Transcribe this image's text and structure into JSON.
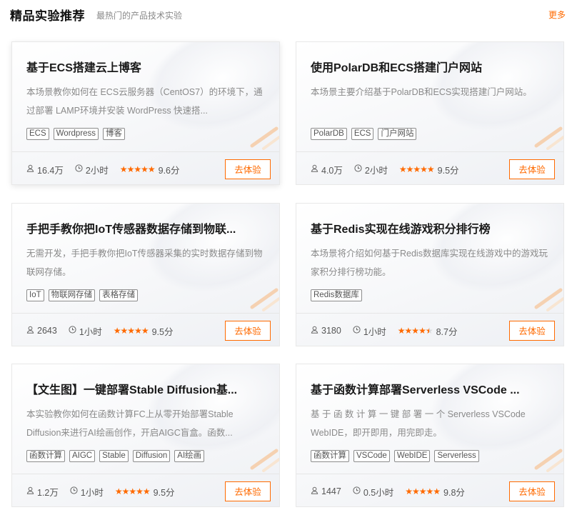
{
  "header": {
    "title": "精品实验推荐",
    "subtitle": "最热门的产品技术实验",
    "more": "更多"
  },
  "cards": [
    {
      "title": "基于ECS搭建云上博客",
      "desc": "本场景教你如何在 ECS云服务器（CentOS7）的环境下，通过部署 LAMP环境并安装 WordPress 快速搭...",
      "tags": [
        "ECS",
        "Wordpress",
        "博客"
      ],
      "users": "16.4万",
      "duration": "2小时",
      "rating": 5,
      "score": "9.6分",
      "button": "去体验"
    },
    {
      "title": "使用PolarDB和ECS搭建门户网站",
      "desc": "本场景主要介绍基于PolarDB和ECS实现搭建门户网站。",
      "tags": [
        "PolarDB",
        "ECS",
        "门户网站"
      ],
      "users": "4.0万",
      "duration": "2小时",
      "rating": 5,
      "score": "9.5分",
      "button": "去体验"
    },
    {
      "title": "手把手教你把IoT传感器数据存储到物联...",
      "desc": "无需开发，手把手教你把IoT传感器采集的实时数据存储到物联网存储。",
      "tags": [
        "IoT",
        "物联网存储",
        "表格存储"
      ],
      "users": "2643",
      "duration": "1小时",
      "rating": 5,
      "score": "9.5分",
      "button": "去体验"
    },
    {
      "title": "基于Redis实现在线游戏积分排行榜",
      "desc": "本场景将介绍如何基于Redis数据库实现在线游戏中的游戏玩家积分排行榜功能。",
      "tags": [
        "Redis数据库"
      ],
      "users": "3180",
      "duration": "1小时",
      "rating": 4.5,
      "score": "8.7分",
      "button": "去体验"
    },
    {
      "title": "【文生图】一键部署Stable Diffusion基...",
      "desc": "本实验教你如何在函数计算FC上从零开始部署Stable Diffusion来进行AI绘画创作，开启AIGC盲盒。函数...",
      "tags": [
        "函数计算",
        "AIGC",
        "Stable",
        "Diffusion",
        "AI绘画"
      ],
      "users": "1.2万",
      "duration": "1小时",
      "rating": 5,
      "score": "9.5分",
      "button": "去体验"
    },
    {
      "title": "基于函数计算部署Serverless VSCode ...",
      "desc": "基 于 函 数 计 算 一 键 部 署 一 个 Serverless  VSCode WebIDE，即开即用，用完即走。",
      "tags": [
        "函数计算",
        "VSCode",
        "WebIDE",
        "Serverless"
      ],
      "users": "1447",
      "duration": "0.5小时",
      "rating": 5,
      "score": "9.8分",
      "button": "去体验"
    }
  ]
}
